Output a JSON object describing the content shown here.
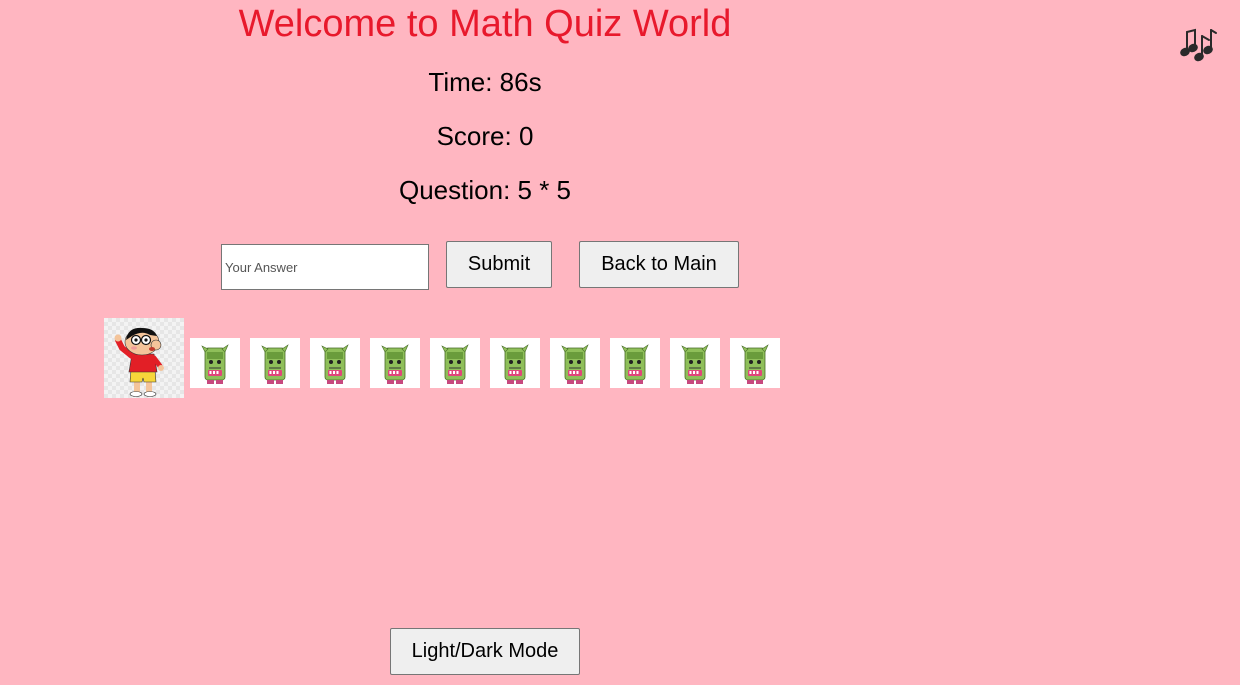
{
  "title": "Welcome to Math Quiz World",
  "time_text": "Time: 86s",
  "score_text": "Score: 0",
  "question_text": "Question: 5 * 5",
  "answer": {
    "placeholder": "Your Answer",
    "value": ""
  },
  "buttons": {
    "submit": "Submit",
    "back": "Back to Main",
    "mode": "Light/Dark Mode"
  },
  "icons": {
    "music": "music-notes-icon",
    "character": "character-avatar",
    "zombie": "zombie-can-icon"
  },
  "remaining_enemies": 10,
  "colors": {
    "background": "#ffb6c1",
    "title": "#e8192c"
  }
}
